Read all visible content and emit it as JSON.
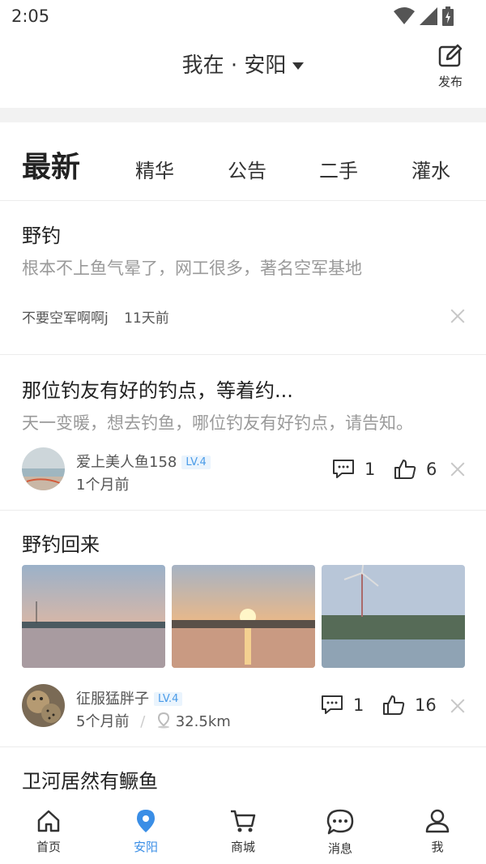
{
  "status_bar": {
    "time": "2:05"
  },
  "header": {
    "location": "我在 · 安阳",
    "publish_label": "发布"
  },
  "tabs": [
    {
      "label": "最新",
      "active": true
    },
    {
      "label": "精华",
      "active": false
    },
    {
      "label": "公告",
      "active": false
    },
    {
      "label": "二手",
      "active": false
    },
    {
      "label": "灌水",
      "active": false
    }
  ],
  "posts": [
    {
      "title": "野钓",
      "excerpt": "根本不上鱼气晕了，网工很多，著名空军基地",
      "author": "不要空军啊啊j",
      "time": "11天前"
    },
    {
      "title": "那位钓友有好的钓点，等着约...",
      "excerpt": "天一变暖，想去钓鱼，哪位钓友有好钓点，请告知。",
      "author": "爱上美人鱼158",
      "level": "LV.4",
      "time": "1个月前",
      "comments": "1",
      "likes": "6"
    },
    {
      "title": "野钓回来",
      "author": "征服猛胖子",
      "level": "LV.4",
      "time": "5个月前",
      "separator": "/",
      "distance": "32.5km",
      "comments": "1",
      "likes": "16"
    },
    {
      "title": "卫河居然有鳜鱼"
    }
  ],
  "bottom_nav": [
    {
      "label": "首页",
      "icon": "home-icon",
      "active": false
    },
    {
      "label": "安阳",
      "icon": "location-pin-icon",
      "active": true
    },
    {
      "label": "商城",
      "icon": "cart-icon",
      "active": false
    },
    {
      "label": "消息",
      "icon": "message-icon",
      "active": false
    },
    {
      "label": "我",
      "icon": "user-icon",
      "active": false
    }
  ],
  "colors": {
    "accent": "#3a8ee6",
    "level_badge": "#4a9be8",
    "muted_text": "#9a9a9a"
  }
}
